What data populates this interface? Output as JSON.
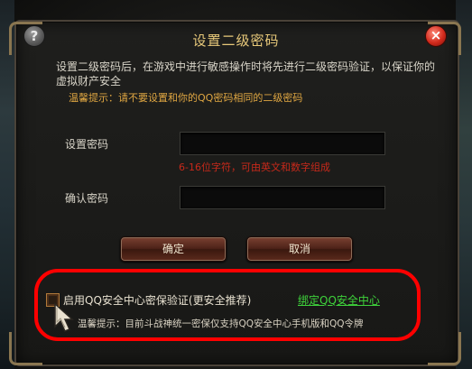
{
  "dialog": {
    "title": "设置二级密码",
    "help_glyph": "?",
    "close_glyph": "×",
    "description": "设置二级密码后，在游戏中进行敏感操作时将先进行二级密码验证，以保证你的虚拟财产安全",
    "tip": "温馨提示：请不要设置和你的QQ密码相同的二级密码"
  },
  "form": {
    "password_label": "设置密码",
    "password_hint": "6-16位字符，可由英文和数字组成",
    "confirm_label": "确认密码"
  },
  "buttons": {
    "confirm": "确定",
    "cancel": "取消"
  },
  "security": {
    "checkbox_label": "启用QQ安全中心密保验证(更安全推荐)",
    "checkbox_checked": false,
    "bind_link": "绑定QQ安全中心",
    "tip": "温馨提示：目前斗战神统一密保仅支持QQ安全中心手机版和QQ令牌"
  },
  "icons": {
    "help": "help-icon",
    "close": "close-icon",
    "cursor": "mouse-pointer-icon"
  },
  "colors": {
    "title": "#e8c97a",
    "tip": "#e0a742",
    "hint": "#c7291a",
    "link": "#3ed33b",
    "highlight": "#ff0000"
  }
}
